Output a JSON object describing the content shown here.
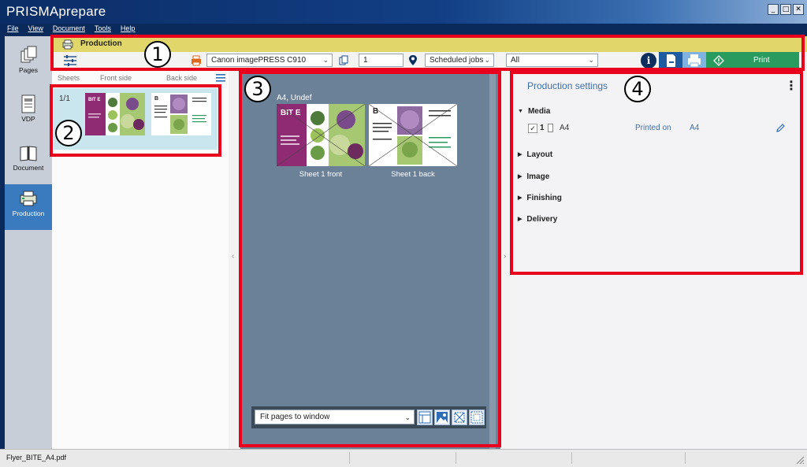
{
  "app": {
    "title": "PRISMAprepare"
  },
  "window_controls": [
    "minimize",
    "maximize",
    "close"
  ],
  "menu": [
    "File",
    "View",
    "Document",
    "Tools",
    "Help"
  ],
  "nav": [
    {
      "label": "Pages",
      "icon": "pages-icon"
    },
    {
      "label": "VDP",
      "icon": "vdp-icon"
    },
    {
      "label": "Document",
      "icon": "document-icon"
    },
    {
      "label": "Production",
      "icon": "production-icon",
      "active": true
    }
  ],
  "production": {
    "title": "Production",
    "printer": "Canon imagePRESS C910",
    "copies": "1",
    "location": "Scheduled jobs",
    "filter": "All",
    "print_label": "Print"
  },
  "sheets": {
    "columns": [
      "Sheets",
      "Front side",
      "Back side"
    ],
    "rows": [
      {
        "index": "1/1"
      }
    ]
  },
  "preview": {
    "media_label": "A4, Undef",
    "sheets": [
      {
        "caption": "Sheet 1 front"
      },
      {
        "caption": "Sheet 1 back"
      }
    ],
    "fit_option": "Fit pages to window"
  },
  "thumbnail_text": {
    "brand": "BIT E"
  },
  "settings": {
    "title": "Production settings",
    "sections": [
      "Media",
      "Layout",
      "Image",
      "Finishing",
      "Delivery"
    ],
    "media_row": {
      "checked": "✓",
      "number": "1",
      "size": "A4",
      "printed_label": "Printed on",
      "printed_value": "A4"
    }
  },
  "status": {
    "filename": "Flyer_BITE_A4.pdf"
  },
  "callouts": [
    "1",
    "2",
    "3",
    "4"
  ],
  "colors": {
    "title_bar": "#0b2d66",
    "production_header": "#e0d66a",
    "print_button": "#2a9b5e",
    "preview_bg": "#6b8197",
    "callout_red": "#e8001c",
    "link_blue": "#3e6ea8"
  }
}
